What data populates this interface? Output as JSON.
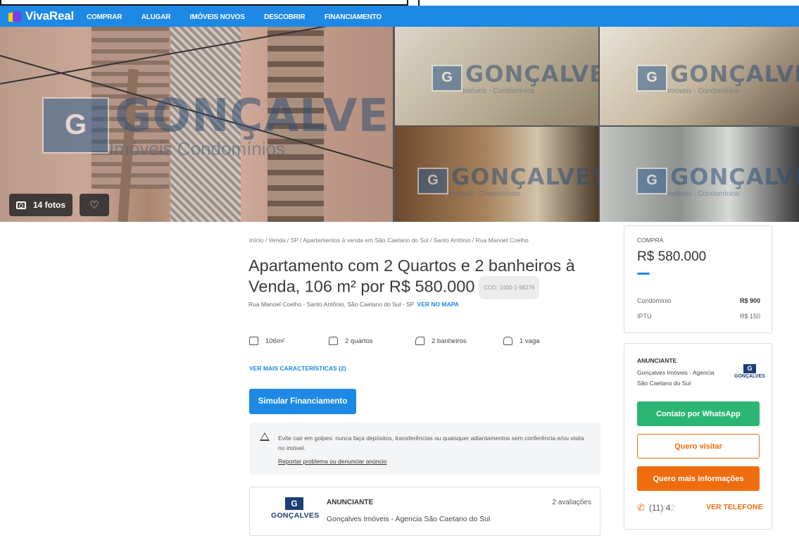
{
  "header": {
    "brand": "VivaReal",
    "nav": [
      "COMPRAR",
      "ALUGAR",
      "IMÓVEIS NOVOS",
      "DESCOBRIR",
      "FINANCIAMENTO"
    ]
  },
  "gallery": {
    "photo_count": "14 fotos",
    "watermark": "GONÇALVES",
    "watermark_sub_main": "Imóveis Condomínios",
    "watermark_sub_tl": "Imóveis - Condomínios",
    "watermark_sub_tr": "Imóveis - Condomínios",
    "watermark_sub_bl": "Imóveis - Condomínios",
    "watermark_sub_br": "Imóveis - Condomínios"
  },
  "listing": {
    "breadcrumb": "Início / Venda / SP / Apartamentos à venda em São Caetano do Sul / Santo Antônio / Rua Manoel Coelho",
    "title": "Apartamento com 2 Quartos e 2 banheiros à Venda, 106 m² por R$ 580.000",
    "code": "COD. 1000-1-98276",
    "address": "Rua Manoel Coelho - Santo Antônio, São Caetano do Sul - SP",
    "map_link": "VER NO MAPA",
    "features": {
      "area": "106m²",
      "bedrooms": "2 quartos",
      "bathrooms": "2 banheiros",
      "parking": "1 vaga"
    },
    "more_features": "VER MAIS CARACTERÍSTICAS (2)",
    "simulate_button": "Simular Financiamento",
    "warning": "Evite cair em golpes: nunca faça depósitos, transferências ou quaisquer adiantamentos sem conferência e/ou visita no imóvel.",
    "report_link": "Reportar problema ou denunciar anúncio",
    "advertiser_card": {
      "label": "ANUNCIANTE",
      "name": "Gonçalves Imóveis - Agencia São Caetano do Sul",
      "reviews": "2 avaliações",
      "logo_text": "GONÇALVES"
    }
  },
  "price_box": {
    "label": "COMPRA",
    "price": "R$ 580.000",
    "condo_label": "Condomínio",
    "condo_value": "R$ 900",
    "iptu_label": "IPTU",
    "iptu_value": "R$ 150"
  },
  "advertiser_box": {
    "label": "ANUNCIANTE",
    "name": "Gonçalves Imóveis - Agencia São Caetano do Sul",
    "logo_text": "GONÇALVES",
    "whatsapp_button": "Contato por WhatsApp",
    "visit_button": "Quero visitar",
    "info_button": "Quero mais informações",
    "phone_prefix": "(11) 4",
    "phone_fade": "2",
    "phone_link": "VER TELEFONE"
  },
  "colors": {
    "brand_blue": "#1e88e5",
    "whatsapp_green": "#2bb673",
    "accent_orange": "#f06d0f"
  }
}
